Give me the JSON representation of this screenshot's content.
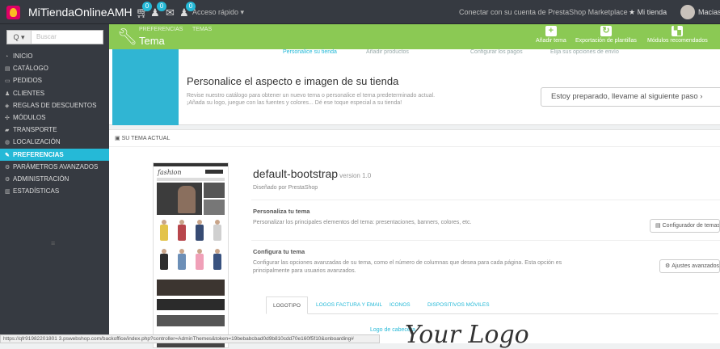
{
  "topbar": {
    "shop_name": "MiTiendaOnlineAMH",
    "badges": [
      "0",
      "0",
      "0"
    ],
    "quick_access": "Acceso rápido ▾",
    "connect": "Conectar con su cuenta de PrestaShop Marketplace",
    "my_store": "★ Mi tienda",
    "user": "Macias Alt"
  },
  "sidebar": {
    "search_button": "Q ▾",
    "search_placeholder": "Buscar",
    "items": [
      {
        "label": "INICIO",
        "icon": "tachometer-icon"
      },
      {
        "label": "CATÁLOGO",
        "icon": "book-icon"
      },
      {
        "label": "PEDIDOS",
        "icon": "credit-card-icon"
      },
      {
        "label": "CLIENTES",
        "icon": "users-icon"
      },
      {
        "label": "REGLAS DE DESCUENTOS",
        "icon": "tag-icon"
      },
      {
        "label": "MÓDULOS",
        "icon": "puzzle-icon"
      },
      {
        "label": "TRANSPORTE",
        "icon": "truck-icon"
      },
      {
        "label": "LOCALIZACIÓN",
        "icon": "globe-icon"
      },
      {
        "label": "PREFERENCIAS",
        "icon": "wrench-icon",
        "active": true
      },
      {
        "label": "PARÁMETROS AVANZADOS",
        "icon": "cogs-icon"
      },
      {
        "label": "ADMINISTRACIÓN",
        "icon": "cog-icon"
      },
      {
        "label": "ESTADÍSTICAS",
        "icon": "bar-chart-icon"
      }
    ],
    "collapse_icon": "≡"
  },
  "header": {
    "breadcrumb_1": "PREFERENCIAS",
    "breadcrumb_2": "TEMAS",
    "title": "Tema",
    "toolbar": [
      {
        "label": "Añadir tema",
        "icon": "+"
      },
      {
        "label": "Exportación de plantillas",
        "icon": "↻"
      },
      {
        "label": "Módulos recomendados",
        "icon": "▚"
      }
    ]
  },
  "onboarding": {
    "steps": [
      "Personalice su tienda",
      "Añadir productos",
      "Configurar los pagos",
      "Elija sus opciones de envío"
    ],
    "title": "Personalice el aspecto e imagen de su tienda",
    "desc_1": "Revise nuestro catálogo para obtener un nuevo tema o personalice el tema predeterminado actual.",
    "desc_2": "¡Añada su logo, juegue con las fuentes y colores... Dé ese toque especial a su tienda!",
    "button": "Estoy preparado, llevame al siguiente paso  ›"
  },
  "current_theme": {
    "panel_title": "SU TEMA ACTUAL",
    "preview_logo": "fashion",
    "name": "default-bootstrap",
    "version": "version 1.0",
    "author": "Diseñado por PrestaShop",
    "customize_title": "Personaliza tu tema",
    "customize_desc": "Personalizar los principales elementos del tema: presentaciones, banners, colores, etc.",
    "customize_button": "Configurador de temas",
    "configure_title": "Configura tu tema",
    "configure_desc": "Configurar las opciones avanzadas de su tema, como el número de columnas que desea para cada página. Esta opción es principalmente para usuarios avanzados.",
    "configure_button": "Ajustes avanzados",
    "tabs": [
      "LOGOTIPO",
      "LOGOS FACTURA Y EMAIL",
      "ICONOS",
      "DISPOSITIVOS MÓVILES"
    ],
    "logo_label": "Logo de cabecera",
    "logo_text": "Your Logo"
  },
  "status_url": "https://qfr91982201801 3.pswebshop.com/backoffice/index.php?controller=AdminThemes&token=19bebabcbad0d9b810cdd70e160f5f10&onboarding#"
}
